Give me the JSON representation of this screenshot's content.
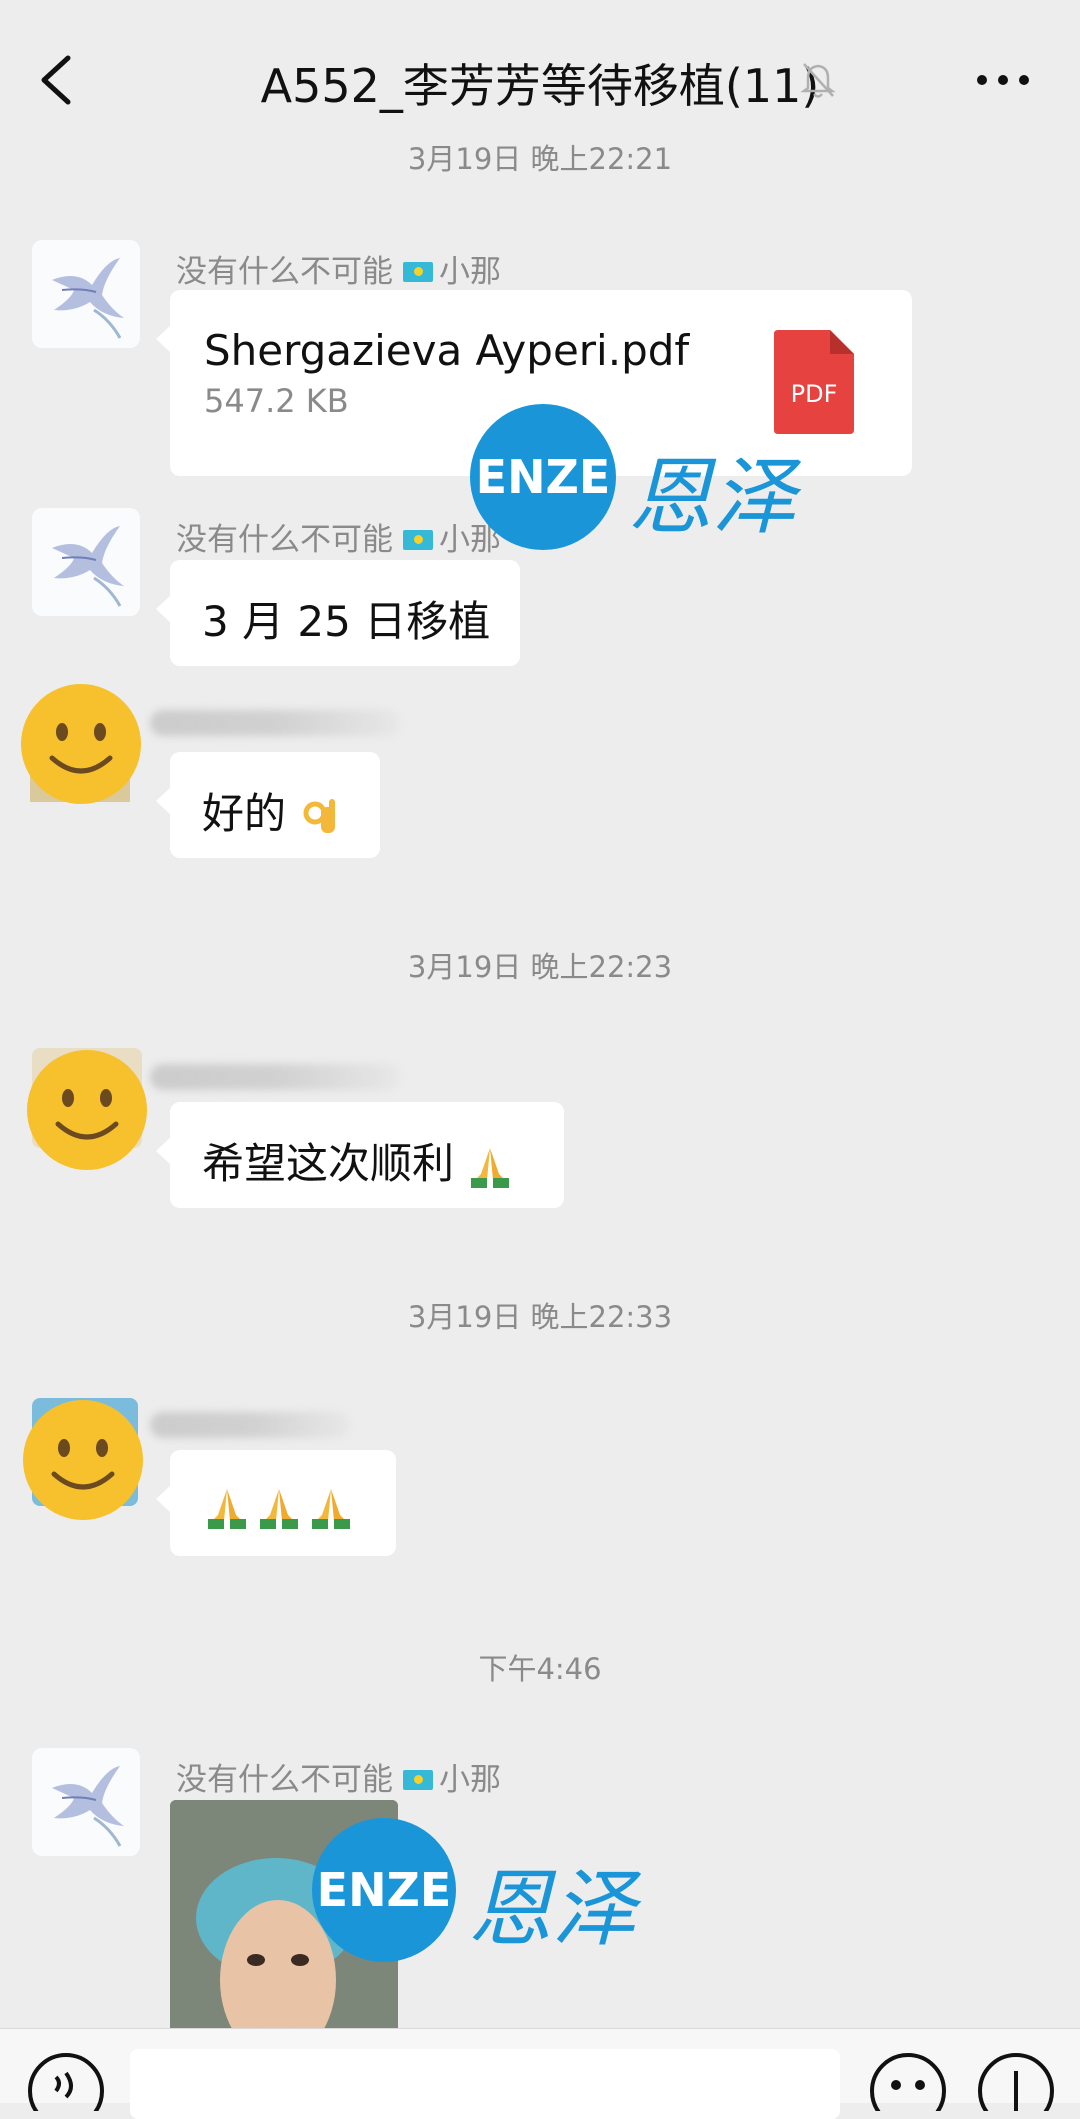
{
  "header": {
    "title": "A552_李芳芳等待移植(11)",
    "back_icon": "chevron-left-icon",
    "mute_icon": "bell-off-icon",
    "more_icon": "more-icon"
  },
  "messages": {
    "t1": "3月19日 晚上22:21",
    "m1_sender": "没有什么不可能",
    "m1_sender_suffix": "小那",
    "m1_file_name": "Shergazieva Ayperi.pdf",
    "m1_file_size": "547.2 KB",
    "m1_file_badge": "PDF",
    "m2_sender": "没有什么不可能",
    "m2_sender_suffix": "小那",
    "m2_text": "3 月 25 日移植",
    "m3_text": "好的",
    "t2": "3月19日 晚上22:23",
    "m4_text": "希望这次顺利",
    "t3": "3月19日 晚上22:33",
    "t4": "下午4:46",
    "m6_sender": "没有什么不可能",
    "m6_sender_suffix": "小那"
  },
  "watermark": {
    "brand": "ENZE",
    "brand_cn": "恩泽"
  },
  "colors": {
    "background": "#ededed",
    "bubble": "#ffffff",
    "pdf_red": "#e64340",
    "watermark_blue": "#1a95d8"
  }
}
